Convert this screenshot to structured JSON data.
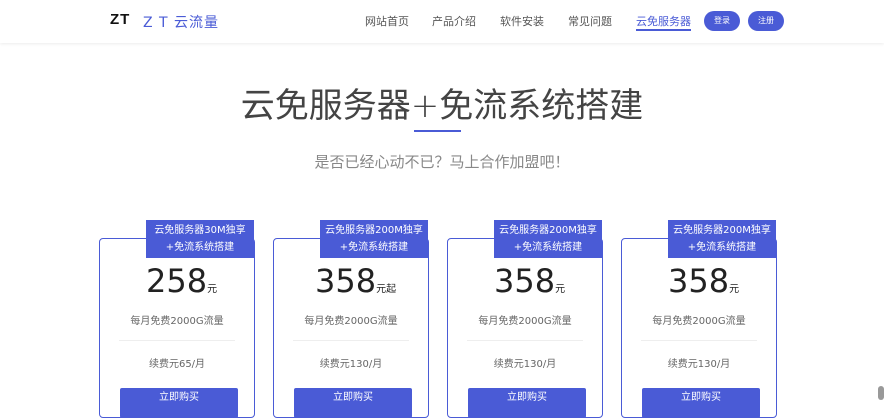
{
  "header": {
    "logo_mark": "ZT",
    "logo_text": "Z T 云流量",
    "nav": [
      {
        "label": "网站首页"
      },
      {
        "label": "产品介绍"
      },
      {
        "label": "软件安装"
      },
      {
        "label": "常见问题"
      },
      {
        "label": "云免服务器"
      }
    ],
    "login_label": "登录",
    "register_label": "注册"
  },
  "hero": {
    "title": "云免服务器+免流系统搭建",
    "subtitle": "是否已经心动不已？马上合作加盟吧！"
  },
  "plans": [
    {
      "ribbon": "云免服务器30M独享+免流系统搭建",
      "price": "258",
      "unit": "元",
      "feature": "每月免费2000G流量",
      "renew": "续费元65/月",
      "button": "立即购买"
    },
    {
      "ribbon": "云免服务器200M独享+免流系统搭建",
      "price": "358",
      "unit": "元起",
      "feature": "每月免费2000G流量",
      "renew": "续费元130/月",
      "button": "立即购买"
    },
    {
      "ribbon": "云免服务器200M独享+免流系统搭建",
      "price": "358",
      "unit": "元",
      "feature": "每月免费2000G流量",
      "renew": "续费元130/月",
      "button": "立即购买"
    },
    {
      "ribbon": "云免服务器200M独享+免流系统搭建",
      "price": "358",
      "unit": "元",
      "feature": "每月免费2000G流量",
      "renew": "续费元130/月",
      "button": "立即购买"
    }
  ],
  "colors": {
    "accent": "#4a5bd6"
  }
}
